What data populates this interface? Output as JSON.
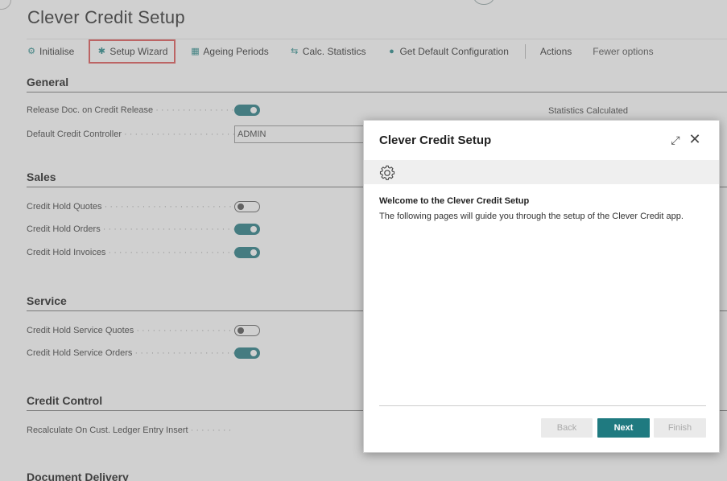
{
  "page": {
    "title": "Clever Credit Setup"
  },
  "actionbar": {
    "initialise": "Initialise",
    "setup_wizard": "Setup Wizard",
    "ageing_periods": "Ageing Periods",
    "calc_statistics": "Calc. Statistics",
    "get_default_configuration": "Get Default Configuration",
    "actions": "Actions",
    "fewer_options": "Fewer options"
  },
  "general": {
    "heading": "General",
    "release_doc_label": "Release Doc. on Credit Release",
    "release_doc_value": true,
    "default_controller_label": "Default Credit Controller",
    "default_controller_value": "ADMIN",
    "statistics_calculated_label": "Statistics Calculated"
  },
  "sales": {
    "heading": "Sales",
    "fields": [
      {
        "label": "Credit Hold Quotes",
        "value": false
      },
      {
        "label": "Credit Hold Orders",
        "value": true
      },
      {
        "label": "Credit Hold Invoices",
        "value": true
      }
    ]
  },
  "service": {
    "heading": "Service",
    "fields": [
      {
        "label": "Credit Hold Service Quotes",
        "value": false
      },
      {
        "label": "Credit Hold Service Orders",
        "value": true
      }
    ]
  },
  "credit_control": {
    "heading": "Credit Control",
    "recalc_label": "Recalculate On Cust. Ledger Entry Insert"
  },
  "document_delivery": {
    "heading": "Document Delivery"
  },
  "dialog": {
    "title": "Clever Credit Setup",
    "welcome": "Welcome to the Clever Credit Setup",
    "description": "The following pages will guide you through the setup of the Clever Credit app.",
    "back_label": "Back",
    "next_label": "Next",
    "finish_label": "Finish"
  },
  "icons": {
    "initialise": "initialise-icon",
    "setup_wizard": "wizard-icon",
    "ageing_periods": "ageing-icon",
    "calc_statistics": "statistics-icon",
    "get_default_configuration": "check-circle-icon",
    "dialog_expand": "expand-icon",
    "dialog_close": "close-icon",
    "dialog_gear": "gear-icon"
  },
  "colors": {
    "accent": "#1f7a80",
    "highlight_box": "#e05a5a"
  }
}
